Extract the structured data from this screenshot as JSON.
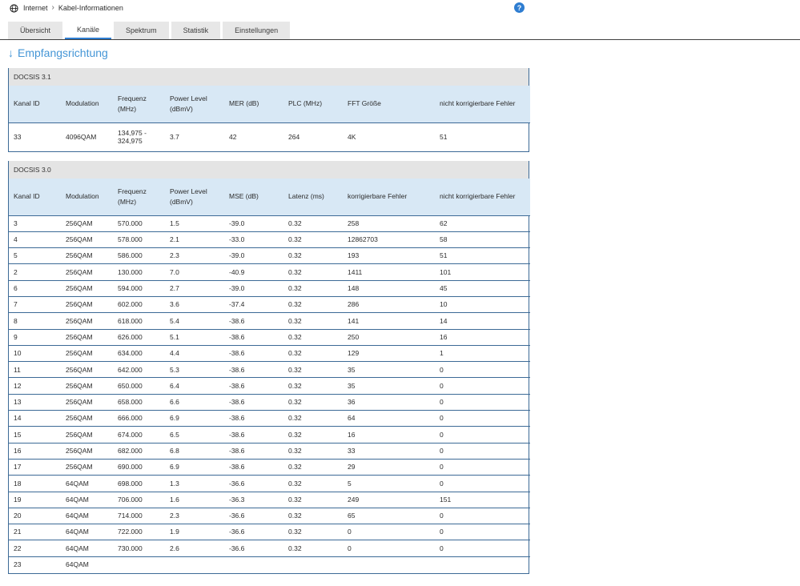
{
  "colors": {
    "accent_blue": "#2e7dd1",
    "heading_blue": "#4596d6",
    "table_header_bg": "#d8e8f5",
    "table_border": "#3c6a96",
    "title_bar_bg": "#e4e4e4"
  },
  "topbar": {
    "breadcrumb": [
      "Internet",
      "Kabel-Informationen"
    ],
    "help_label": "?"
  },
  "tabs": [
    {
      "label": "Übersicht",
      "active": false
    },
    {
      "label": "Kanäle",
      "active": true
    },
    {
      "label": "Spektrum",
      "active": false
    },
    {
      "label": "Statistik",
      "active": false
    },
    {
      "label": "Einstellungen",
      "active": false
    }
  ],
  "section": {
    "arrow": "↓",
    "title": "Empfangsrichtung"
  },
  "tables": [
    {
      "title": "DOCSIS 3.1",
      "columns": [
        "Kanal ID",
        "Modulation",
        "Frequenz (MHz)",
        "Power Level (dBmV)",
        "MER (dB)",
        "PLC (MHz)",
        "FFT Größe",
        "nicht korrigierbare Fehler"
      ],
      "rows": [
        [
          "33",
          "4096QAM",
          "134,975 - 324,975",
          "3.7",
          "42",
          "264",
          "4K",
          "51"
        ]
      ]
    },
    {
      "title": "DOCSIS 3.0",
      "columns": [
        "Kanal ID",
        "Modulation",
        "Frequenz (MHz)",
        "Power Level (dBmV)",
        "MSE (dB)",
        "Latenz (ms)",
        "korrigierbare Fehler",
        "nicht korrigierbare Fehler"
      ],
      "rows": [
        [
          "3",
          "256QAM",
          "570.000",
          "1.5",
          "-39.0",
          "0.32",
          "258",
          "62"
        ],
        [
          "4",
          "256QAM",
          "578.000",
          "2.1",
          "-33.0",
          "0.32",
          "12862703",
          "58"
        ],
        [
          "5",
          "256QAM",
          "586.000",
          "2.3",
          "-39.0",
          "0.32",
          "193",
          "51"
        ],
        [
          "2",
          "256QAM",
          "130.000",
          "7.0",
          "-40.9",
          "0.32",
          "1411",
          "101"
        ],
        [
          "6",
          "256QAM",
          "594.000",
          "2.7",
          "-39.0",
          "0.32",
          "148",
          "45"
        ],
        [
          "7",
          "256QAM",
          "602.000",
          "3.6",
          "-37.4",
          "0.32",
          "286",
          "10"
        ],
        [
          "8",
          "256QAM",
          "618.000",
          "5.4",
          "-38.6",
          "0.32",
          "141",
          "14"
        ],
        [
          "9",
          "256QAM",
          "626.000",
          "5.1",
          "-38.6",
          "0.32",
          "250",
          "16"
        ],
        [
          "10",
          "256QAM",
          "634.000",
          "4.4",
          "-38.6",
          "0.32",
          "129",
          "1"
        ],
        [
          "11",
          "256QAM",
          "642.000",
          "5.3",
          "-38.6",
          "0.32",
          "35",
          "0"
        ],
        [
          "12",
          "256QAM",
          "650.000",
          "6.4",
          "-38.6",
          "0.32",
          "35",
          "0"
        ],
        [
          "13",
          "256QAM",
          "658.000",
          "6.6",
          "-38.6",
          "0.32",
          "36",
          "0"
        ],
        [
          "14",
          "256QAM",
          "666.000",
          "6.9",
          "-38.6",
          "0.32",
          "64",
          "0"
        ],
        [
          "15",
          "256QAM",
          "674.000",
          "6.5",
          "-38.6",
          "0.32",
          "16",
          "0"
        ],
        [
          "16",
          "256QAM",
          "682.000",
          "6.8",
          "-38.6",
          "0.32",
          "33",
          "0"
        ],
        [
          "17",
          "256QAM",
          "690.000",
          "6.9",
          "-38.6",
          "0.32",
          "29",
          "0"
        ],
        [
          "18",
          "64QAM",
          "698.000",
          "1.3",
          "-36.6",
          "0.32",
          "5",
          "0"
        ],
        [
          "19",
          "64QAM",
          "706.000",
          "1.6",
          "-36.3",
          "0.32",
          "249",
          "151"
        ],
        [
          "20",
          "64QAM",
          "714.000",
          "2.3",
          "-36.6",
          "0.32",
          "65",
          "0"
        ],
        [
          "21",
          "64QAM",
          "722.000",
          "1.9",
          "-36.6",
          "0.32",
          "0",
          "0"
        ],
        [
          "22",
          "64QAM",
          "730.000",
          "2.6",
          "-36.6",
          "0.32",
          "0",
          "0"
        ],
        [
          "23",
          "64QAM",
          "",
          "",
          "",
          "",
          "",
          ""
        ]
      ]
    }
  ]
}
